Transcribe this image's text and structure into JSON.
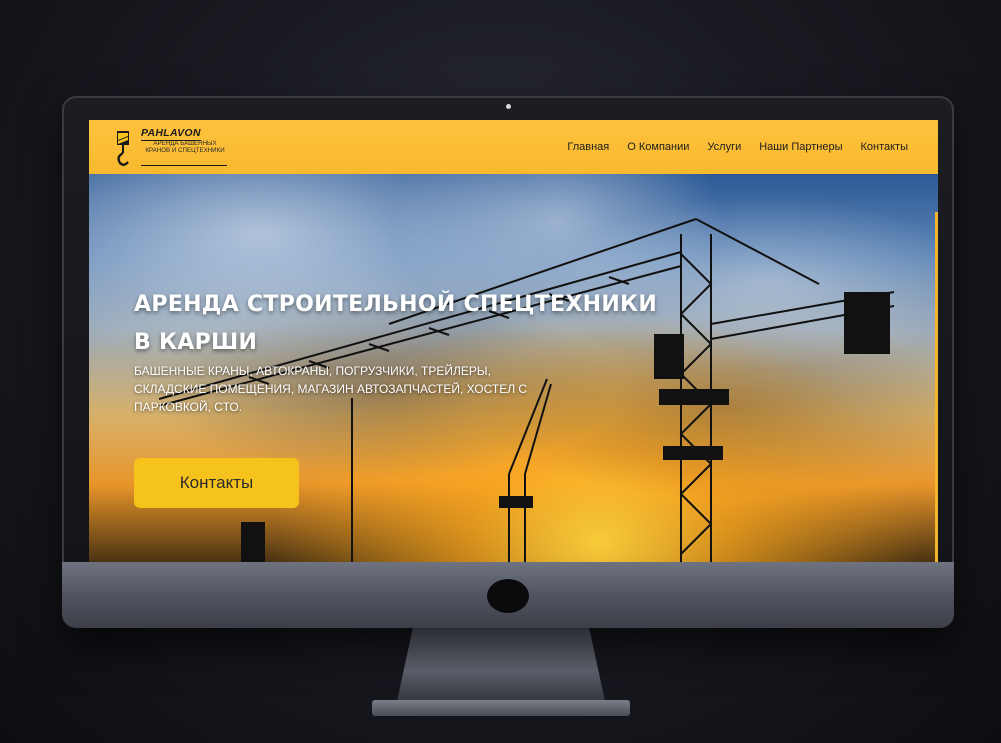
{
  "brand": {
    "name": "PAHLAVON",
    "tagline": "АРЕНДА БАШЕННЫХ КРАНОВ И СПЕЦТЕХНИКИ"
  },
  "nav": {
    "items": [
      "Главная",
      "О Компании",
      "Услуги",
      "Наши Партнеры",
      "Контакты"
    ]
  },
  "hero": {
    "title_line1": "АРЕНДА СТРОИТЕЛЬНОЙ СПЕЦТЕХНИКИ",
    "title_line2": "В КАРШИ",
    "subtitle": "БАШЕННЫЕ КРАНЫ, АВТОКРАНЫ, ПОГРУЗЧИКИ, ТРЕЙЛЕРЫ, СКЛАДСКИЕ ПОМЕЩЕНИЯ, МАГАЗИН АВТОЗАПЧАСТЕЙ, ХОСТЕЛ С ПАРКОВКОЙ, СТО.",
    "button_label": "Контакты"
  },
  "colors": {
    "accent": "#f6c21c",
    "navbar": "#ffc23d",
    "text_dark": "#1d1d1d"
  },
  "icons": {
    "brand_mark": "crane-hook-icon"
  }
}
